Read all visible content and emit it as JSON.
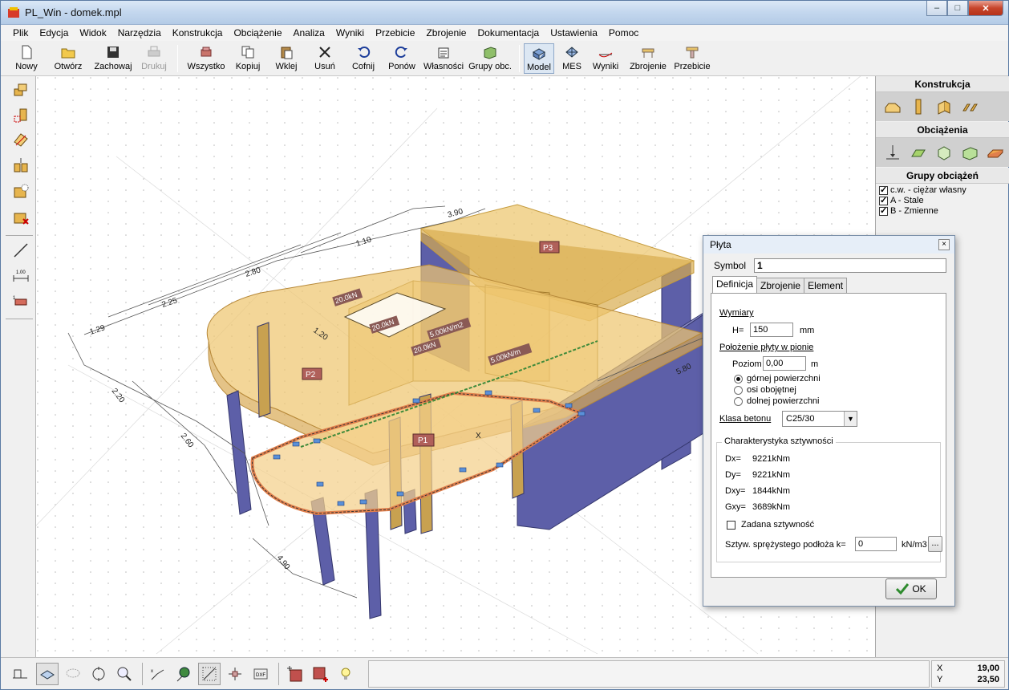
{
  "window": {
    "title": "PL_Win - domek.mpl",
    "min": "–",
    "max": "□",
    "close": "✕"
  },
  "menu": [
    "Plik",
    "Edycja",
    "Widok",
    "Narzędzia",
    "Konstrukcja",
    "Obciążenie",
    "Analiza",
    "Wyniki",
    "Przebicie",
    "Zbrojenie",
    "Dokumentacja",
    "Ustawienia",
    "Pomoc"
  ],
  "toolbar": {
    "nowy": "Nowy",
    "otworz": "Otwórz",
    "zachowaj": "Zachowaj",
    "drukuj": "Drukuj",
    "wszystko": "Wszystko",
    "kopiuj": "Kopiuj",
    "wklej": "Wklej",
    "usun": "Usuń",
    "cofnij": "Cofnij",
    "ponow": "Ponów",
    "wlasnosci": "Własności",
    "grupy": "Grupy obc.",
    "model": "Model",
    "mes": "MES",
    "wyniki": "Wyniki",
    "zbrojenie": "Zbrojenie",
    "przebicie": "Przebicie"
  },
  "right_panel": {
    "konstrukcja": "Konstrukcja",
    "obciazenia": "Obciążenia",
    "grupy_obciazen": "Grupy obciążeń",
    "groups": [
      {
        "label": "c.w. - ciężar własny",
        "checked": true
      },
      {
        "label": "A - Stale",
        "checked": true
      },
      {
        "label": "B - Zmienne",
        "checked": true
      }
    ]
  },
  "viewport": {
    "plates": [
      "P1",
      "P2",
      "P3"
    ],
    "loads": [
      "20.0kN",
      "20.0kN",
      "20.0kN",
      "5.00kN/m2",
      "5.00kN/m"
    ],
    "dims": [
      "3.90",
      "2.80",
      "2.25",
      "1.29",
      "1.20",
      "2.60",
      "5.80",
      "2.20",
      "4.90",
      "1.10"
    ],
    "axis_x": "X"
  },
  "status": {
    "x_label": "X",
    "x_value": "19,00",
    "y_label": "Y",
    "y_value": "23,50"
  },
  "dialog": {
    "title": "Płyta",
    "close": "×",
    "symbol_label": "Symbol",
    "symbol_value": "1",
    "tabs": [
      "Definicja",
      "Zbrojenie",
      "Element"
    ],
    "wymiary": "Wymiary",
    "h_label": "H=",
    "h_value": "150",
    "h_unit": "mm",
    "polozenie": "Położenie płyty w pionie",
    "poziom_label": "Poziom",
    "poziom_value": "0,00",
    "poziom_unit": "m",
    "radios": [
      {
        "label": "górnej powierzchni",
        "selected": true
      },
      {
        "label": "osi obojętnej",
        "selected": false
      },
      {
        "label": "dolnej powierzchni",
        "selected": false
      }
    ],
    "klasa_label": "Klasa betonu",
    "klasa_value": "C25/30",
    "char_title": "Charakterystyka sztywności",
    "dx_label": "Dx=",
    "dx_value": "9221kNm",
    "dy_label": "Dy=",
    "dy_value": "9221kNm",
    "dxy_label": "Dxy=",
    "dxy_value": "1844kNm",
    "gxy_label": "Gxy=",
    "gxy_value": "3689kNm",
    "zadana": "Zadana sztywność",
    "sztyw_label": "Sztyw. sprężystego podłoża  k=",
    "sztyw_value": "0",
    "sztyw_unit": "kN/m3",
    "more_btn": "...",
    "ok": "OK"
  }
}
